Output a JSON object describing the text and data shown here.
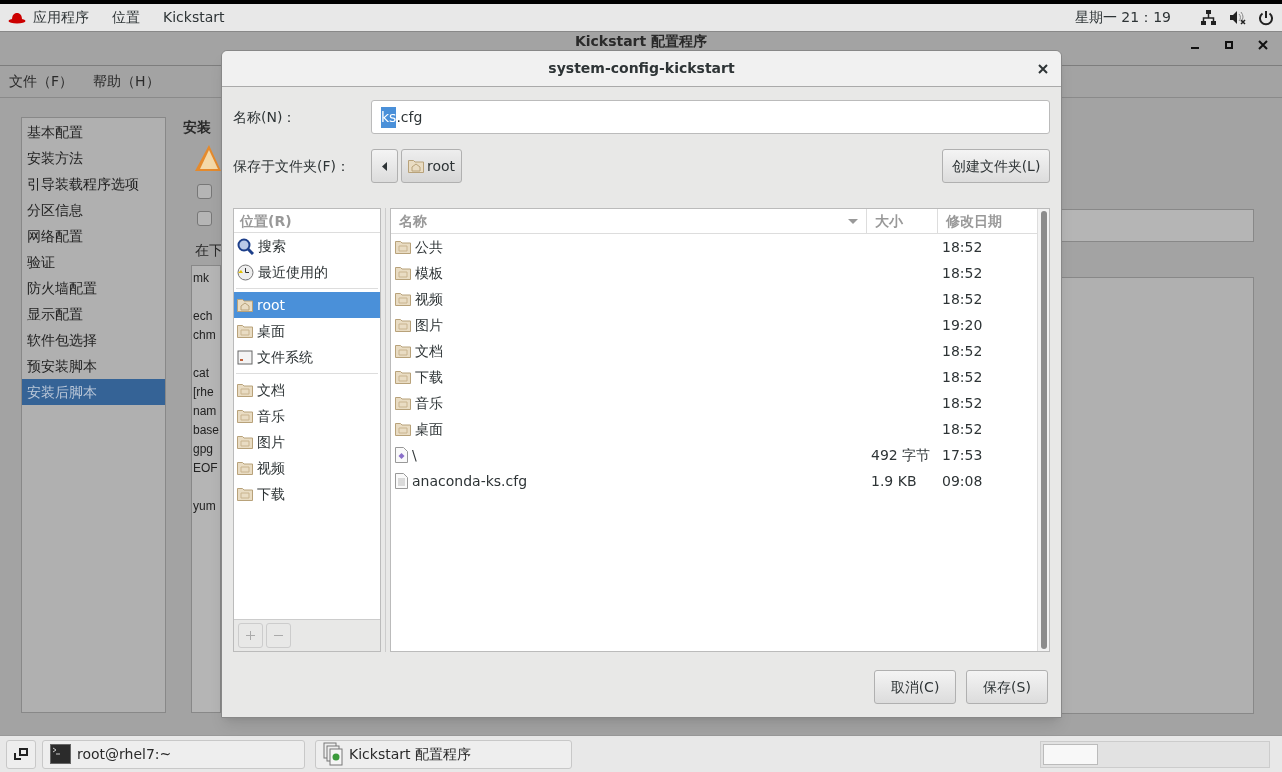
{
  "top_bar": {
    "menus": [
      "应用程序",
      "位置",
      "Kickstart"
    ],
    "clock": "星期一  21：19"
  },
  "main_window": {
    "title": "Kickstart 配置程序",
    "menus": [
      "文件（F）",
      "帮助（H）"
    ],
    "sidebar": [
      {
        "label": "基本配置",
        "selected": false
      },
      {
        "label": "安装方法",
        "selected": false
      },
      {
        "label": "引导装载程序选项",
        "selected": false
      },
      {
        "label": "分区信息",
        "selected": false
      },
      {
        "label": "网络配置",
        "selected": false
      },
      {
        "label": "验证",
        "selected": false
      },
      {
        "label": "防火墙配置",
        "selected": false
      },
      {
        "label": "显示配置",
        "selected": false
      },
      {
        "label": "软件包选择",
        "selected": false
      },
      {
        "label": "预安装脚本",
        "selected": false
      },
      {
        "label": "安装后脚本",
        "selected": true
      }
    ],
    "section_title": "安装",
    "checkboxes": [
      {
        "checked": false
      },
      {
        "checked": false
      }
    ],
    "script_label": "在下",
    "script_paragraphs": [
      [
        "mk"
      ],
      [
        "ech",
        "chm"
      ],
      [
        "cat",
        "[rhe",
        "nam",
        "base",
        "gpg",
        "EOF"
      ],
      [
        "yum"
      ]
    ]
  },
  "dialog": {
    "title": "system-config-kickstart",
    "name_label": "名称(N)：",
    "name_value_selected": "ks",
    "name_value_rest": ".cfg",
    "folder_label": "保存于文件夹(F)：",
    "folder_path": "root",
    "create_folder": "创建文件夹(L)",
    "places": {
      "header": "位置(R)",
      "groups": [
        [
          {
            "label": "搜索",
            "kind": "search",
            "selected": false
          },
          {
            "label": "最近使用的",
            "kind": "recent",
            "selected": false
          }
        ],
        [
          {
            "label": "root",
            "kind": "home",
            "selected": true
          },
          {
            "label": "桌面",
            "kind": "folder",
            "selected": false
          },
          {
            "label": "文件系统",
            "kind": "drive",
            "selected": false
          }
        ],
        [
          {
            "label": "文档",
            "kind": "folder",
            "selected": false
          },
          {
            "label": "音乐",
            "kind": "folder",
            "selected": false
          },
          {
            "label": "图片",
            "kind": "folder",
            "selected": false
          },
          {
            "label": "视频",
            "kind": "folder",
            "selected": false
          },
          {
            "label": "下载",
            "kind": "folder",
            "selected": false
          }
        ]
      ]
    },
    "columns": [
      "名称",
      "大小",
      "修改日期"
    ],
    "files": [
      {
        "name": "公共",
        "modified": "18:52",
        "kind": "folder"
      },
      {
        "name": "模板",
        "modified": "18:52",
        "kind": "folder"
      },
      {
        "name": "视频",
        "modified": "18:52",
        "kind": "folder"
      },
      {
        "name": "图片",
        "modified": "19:20",
        "kind": "folder"
      },
      {
        "name": "文档",
        "modified": "18:52",
        "kind": "folder"
      },
      {
        "name": "下载",
        "modified": "18:52",
        "kind": "folder"
      },
      {
        "name": "音乐",
        "modified": "18:52",
        "kind": "folder"
      },
      {
        "name": "桌面",
        "modified": "18:52",
        "kind": "folder"
      },
      {
        "name": "\\",
        "size": "492 字节",
        "modified": "17:53",
        "kind": "script"
      },
      {
        "name": "anaconda-ks.cfg",
        "size": "1.9 KB",
        "modified": "09:08",
        "kind": "text"
      }
    ],
    "buttons": [
      "取消(C)",
      "保存(S)"
    ]
  },
  "taskbar": [
    {
      "label": "root@rhel7:~",
      "kind": "terminal"
    },
    {
      "label": "Kickstart 配置程序",
      "kind": "kickstart"
    }
  ]
}
